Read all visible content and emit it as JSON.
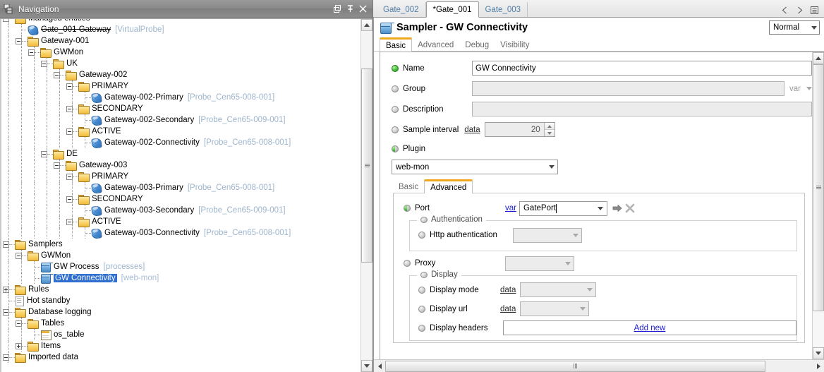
{
  "nav": {
    "title": "Navigation",
    "window_buttons": [
      "restore-icon",
      "pin-icon",
      "close-icon"
    ],
    "tree": [
      {
        "label": "Managed entities",
        "meta": "",
        "icon": "folder-icon",
        "depth": 0,
        "toggle": "minus"
      },
      {
        "label": "Gate_001 Gateway",
        "meta": "[VirtualProbe]",
        "icon": "probe-icon",
        "depth": 1,
        "toggle": "none",
        "struck": true
      },
      {
        "label": "Gateway-001",
        "meta": "",
        "icon": "folder-icon",
        "depth": 1,
        "toggle": "minus"
      },
      {
        "label": "GWMon",
        "meta": "",
        "icon": "folder-icon",
        "depth": 2,
        "toggle": "minus"
      },
      {
        "label": "UK",
        "meta": "",
        "icon": "folder-icon",
        "depth": 3,
        "toggle": "minus"
      },
      {
        "label": "Gateway-002",
        "meta": "",
        "icon": "folder-icon",
        "depth": 4,
        "toggle": "minus"
      },
      {
        "label": "PRIMARY",
        "meta": "",
        "icon": "folder-icon",
        "depth": 5,
        "toggle": "minus"
      },
      {
        "label": "Gateway-002-Primary",
        "meta": "[Probe_Cen65-008-001]",
        "icon": "probe-icon",
        "depth": 6,
        "toggle": "none"
      },
      {
        "label": "SECONDARY",
        "meta": "",
        "icon": "folder-icon",
        "depth": 5,
        "toggle": "minus"
      },
      {
        "label": "Gateway-002-Secondary",
        "meta": "[Probe_Cen65-009-001]",
        "icon": "probe-icon",
        "depth": 6,
        "toggle": "none"
      },
      {
        "label": "ACTIVE",
        "meta": "",
        "icon": "folder-icon",
        "depth": 5,
        "toggle": "minus"
      },
      {
        "label": "Gateway-002-Connectivity",
        "meta": "[Probe_Cen65-008-001]",
        "icon": "probe-icon",
        "depth": 6,
        "toggle": "none"
      },
      {
        "label": "DE",
        "meta": "",
        "icon": "folder-icon",
        "depth": 3,
        "toggle": "minus"
      },
      {
        "label": "Gateway-003",
        "meta": "",
        "icon": "folder-icon",
        "depth": 4,
        "toggle": "minus"
      },
      {
        "label": "PRIMARY",
        "meta": "",
        "icon": "folder-icon",
        "depth": 5,
        "toggle": "minus"
      },
      {
        "label": "Gateway-003-Primary",
        "meta": "[Probe_Cen65-008-001]",
        "icon": "probe-icon",
        "depth": 6,
        "toggle": "none"
      },
      {
        "label": "SECONDARY",
        "meta": "",
        "icon": "folder-icon",
        "depth": 5,
        "toggle": "minus"
      },
      {
        "label": "Gateway-003-Secondary",
        "meta": "[Probe_Cen65-009-001]",
        "icon": "probe-icon",
        "depth": 6,
        "toggle": "none"
      },
      {
        "label": "ACTIVE",
        "meta": "",
        "icon": "folder-icon",
        "depth": 5,
        "toggle": "minus"
      },
      {
        "label": "Gateway-003-Connectivity",
        "meta": "[Probe_Cen65-008-001]",
        "icon": "probe-icon",
        "depth": 6,
        "toggle": "none"
      },
      {
        "label": "Samplers",
        "meta": "",
        "icon": "folder-icon",
        "depth": 0,
        "toggle": "minus"
      },
      {
        "label": "GWMon",
        "meta": "",
        "icon": "folder-icon",
        "depth": 1,
        "toggle": "minus"
      },
      {
        "label": "GW Process",
        "meta": "[processes]",
        "icon": "sampler-icon",
        "depth": 2,
        "toggle": "none"
      },
      {
        "label": "GW Connectivity",
        "meta": "[web-mon]",
        "icon": "sampler-icon",
        "depth": 2,
        "toggle": "none",
        "selected": true
      },
      {
        "label": "Rules",
        "meta": "",
        "icon": "folder-icon",
        "depth": 0,
        "toggle": "plus"
      },
      {
        "label": "Hot standby",
        "meta": "",
        "icon": "doc-icon",
        "depth": 0,
        "toggle": "none"
      },
      {
        "label": "Database logging",
        "meta": "",
        "icon": "folder-icon",
        "depth": 0,
        "toggle": "minus"
      },
      {
        "label": "Tables",
        "meta": "",
        "icon": "folder-icon",
        "depth": 1,
        "toggle": "minus"
      },
      {
        "label": "os_table",
        "meta": "",
        "icon": "table-icon",
        "depth": 2,
        "toggle": "none"
      },
      {
        "label": "Items",
        "meta": "",
        "icon": "folder-icon",
        "depth": 1,
        "toggle": "plus"
      },
      {
        "label": "Imported data",
        "meta": "",
        "icon": "folder-icon",
        "depth": 0,
        "toggle": "minus"
      }
    ]
  },
  "doc_tabs": [
    {
      "label": "Gate_002",
      "active": false
    },
    {
      "label": "*Gate_001",
      "active": true
    },
    {
      "label": "Gate_003",
      "active": false
    }
  ],
  "doc_tab_controls": [
    "prev-icon",
    "next-icon",
    "list-icon"
  ],
  "header": {
    "icon": "sampler-icon",
    "title": "Sampler - GW Connectivity",
    "severity": "Normal"
  },
  "main_tabs": [
    {
      "label": "Basic",
      "active": true
    },
    {
      "label": "Advanced",
      "active": false
    },
    {
      "label": "Debug",
      "active": false
    },
    {
      "label": "Visibility",
      "active": false
    }
  ],
  "form": {
    "name": {
      "label": "Name",
      "value": "GW Connectivity",
      "status": "green"
    },
    "group": {
      "label": "Group",
      "value": "",
      "status": "grey",
      "suffix": "var"
    },
    "description": {
      "label": "Description",
      "value": "",
      "status": "grey"
    },
    "sample_interval": {
      "label": "Sample interval",
      "link": "data",
      "value": "20",
      "status": "grey"
    },
    "plugin": {
      "label": "Plugin",
      "status": "half",
      "value": "web-mon"
    }
  },
  "plugin_tabs": [
    {
      "label": "Basic",
      "active": false
    },
    {
      "label": "Advanced",
      "active": true
    }
  ],
  "plugin_form": {
    "port": {
      "label": "Port",
      "link": "var",
      "value": "GatePort",
      "status": "half"
    },
    "authentication": {
      "legend": "Authentication",
      "status": "grey"
    },
    "http_authentication": {
      "label": "Http authentication",
      "value": "",
      "status": "grey"
    },
    "proxy": {
      "label": "Proxy",
      "value": "",
      "status": "grey"
    },
    "display": {
      "legend": "Display",
      "status": "grey"
    },
    "display_mode": {
      "label": "Display mode",
      "link": "data",
      "value": "",
      "status": "grey"
    },
    "display_url": {
      "label": "Display url",
      "link": "data",
      "value": "",
      "status": "grey"
    },
    "display_headers": {
      "label": "Display headers",
      "action": "Add new",
      "status": "grey"
    }
  },
  "colors": {
    "accent_tab": "#f0a91e",
    "selection": "#2f6fd0",
    "link": "#1a1ad0",
    "meta_text": "#9db4cc"
  }
}
